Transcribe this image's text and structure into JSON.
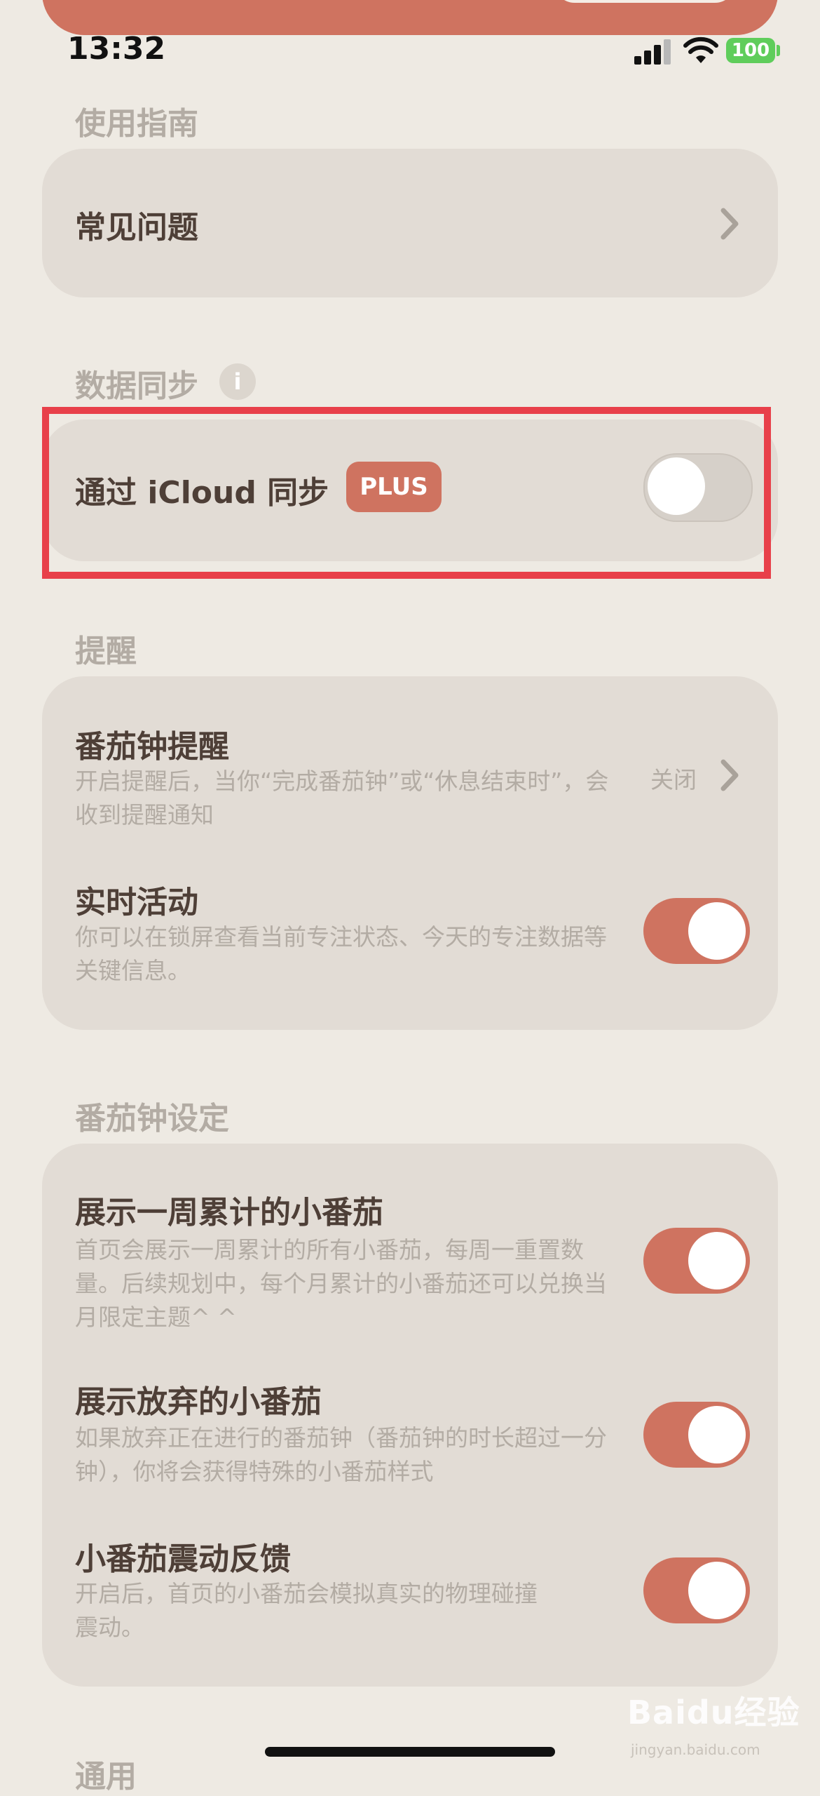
{
  "status_bar": {
    "time": "13:32",
    "battery": "100"
  },
  "sections": {
    "guide": {
      "title": "使用指南",
      "faq_label": "常见问题"
    },
    "sync": {
      "title": "数据同步",
      "info_glyph": "i",
      "icloud_label": "通过 iCloud 同步",
      "badge": "PLUS",
      "icloud_enabled": false
    },
    "reminder": {
      "title": "提醒",
      "pomodoro_reminder": {
        "title": "番茄钟提醒",
        "desc": "开启提醒后，当你“完成番茄钟”或“休息结束时”，会收到提醒通知",
        "value": "关闭"
      },
      "live_activity": {
        "title": "实时活动",
        "desc": "你可以在锁屏查看当前专注状态、今天的专注数据等关键信息。",
        "enabled": true
      }
    },
    "pomodoro_settings": {
      "title": "番茄钟设定",
      "weekly": {
        "title": "展示一周累计的小番茄",
        "desc": "首页会展示一周累计的所有小番茄，每周一重置数量。后续规划中，每个月累计的小番茄还可以兑换当月限定主题^ ^",
        "enabled": true
      },
      "abandoned": {
        "title": "展示放弃的小番茄",
        "desc": "如果放弃正在进行的番茄钟（番茄钟的时长超过一分钟），你将会获得特殊的小番茄样式",
        "enabled": true
      },
      "haptics": {
        "title": "小番茄震动反馈",
        "desc": "开启后，首页的小番茄会模拟真实的物理碰撞震动。",
        "enabled": true
      }
    },
    "general": {
      "title": "通用"
    }
  },
  "watermark": {
    "text": "Baidu经验",
    "sub": "jingyan.baidu.com"
  },
  "colors": {
    "accent": "#cf7360",
    "background": "#eeeae3",
    "card": "#e2dcd5",
    "highlight": "#e8404a"
  },
  "icons": [
    "chevron-right-icon",
    "info-icon",
    "wifi-icon",
    "signal-icon",
    "battery-icon"
  ]
}
